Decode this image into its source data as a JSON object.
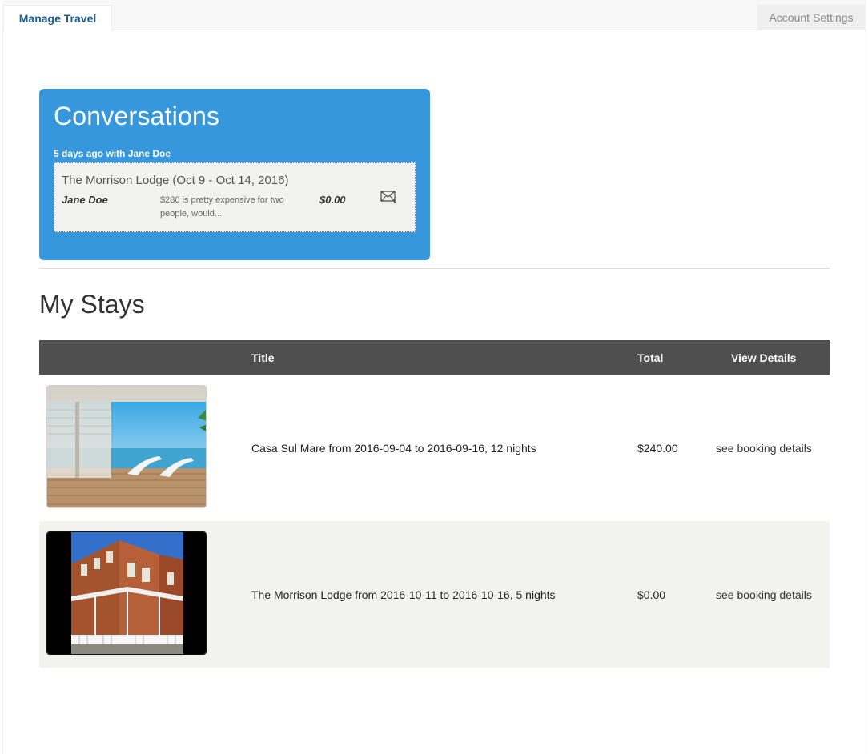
{
  "tabs": {
    "manage_travel": "Manage Travel",
    "account_settings": "Account Settings"
  },
  "conversations": {
    "title": "Conversations",
    "meta": "5 days ago with Jane Doe",
    "card": {
      "title": "The Morrison Lodge (Oct 9 - Oct 14, 2016)",
      "name": "Jane Doe",
      "message": "$280 is pretty expensive for two people, would...",
      "amount": "$0.00",
      "icon": "envelope-icon"
    }
  },
  "stays": {
    "title": "My Stays",
    "columns": {
      "title": "Title",
      "total": "Total",
      "details": "View Details"
    },
    "rows": [
      {
        "image": "beach-room-photo",
        "title": "Casa Sul Mare from 2016-09-04 to 2016-09-16, 12 nights",
        "total": "$240.00",
        "details": "see booking details"
      },
      {
        "image": "brick-lodge-photo",
        "title": "The Morrison Lodge from 2016-10-11 to 2016-10-16, 5 nights",
        "total": "$0.00",
        "details": "see booking details"
      }
    ]
  },
  "colors": {
    "accent_blue": "#3697dc",
    "tab_text": "#1e5f94",
    "table_header": "#4f4f4f",
    "alt_row": "#f2f2ee"
  }
}
